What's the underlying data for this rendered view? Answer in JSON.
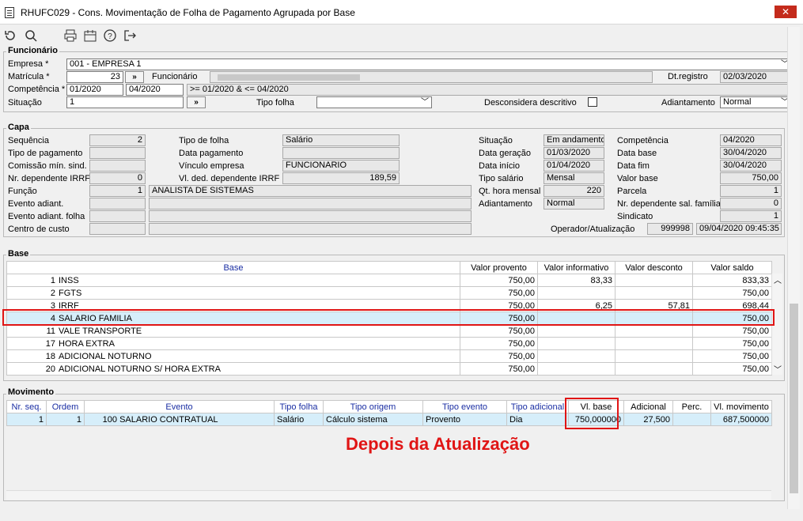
{
  "window": {
    "title": "RHUFC029 - Cons. Movimentação de Folha de Pagamento Agrupada por Base"
  },
  "funcionario": {
    "legend": "Funcionário",
    "empresa_label": "Empresa *",
    "empresa_value": "001 - EMPRESA 1",
    "matricula_label": "Matrícula *",
    "matricula_value": "23",
    "funcionario_label": "Funcionário",
    "dtregistro_label": "Dt.registro",
    "dtregistro_value": "02/03/2020",
    "competencia_label": "Competência *",
    "comp_from": "01/2020",
    "comp_to": "04/2020",
    "comp_range": ">= 01/2020  &  <= 04/2020",
    "situacao_label": "Situação",
    "situacao_value": "1",
    "tipofolha_label": "Tipo folha",
    "desconsidera_label": "Desconsidera descritivo",
    "adiantamento_label": "Adiantamento",
    "adiantamento_value": "Normal",
    "btn_label": "»"
  },
  "capa": {
    "legend": "Capa",
    "sequencia_label": "Sequência",
    "sequencia_value": "2",
    "tipopag_label": "Tipo de pagamento",
    "comissao_label": "Comissão mín. sind.",
    "nrdep_label": "Nr. dependente IRRF",
    "nrdep_value": "0",
    "funcao_label": "Função",
    "funcao_value": "1",
    "funcao_desc": "ANALISTA DE SISTEMAS",
    "evento_adiant_label": "Evento adiant.",
    "evento_adiant_folha_label": "Evento adiant. folha",
    "centro_label": "Centro de custo",
    "tipofolha_label": "Tipo de folha",
    "tipofolha_value": "Salário",
    "datapag_label": "Data pagamento",
    "vinculo_label": "Vínculo empresa",
    "vinculo_value": "FUNCIONARIO",
    "vlded_label": "Vl. ded. dependente IRRF",
    "vlded_value": "189,59",
    "situacao_label": "Situação",
    "situacao_value": "Em andamento",
    "datager_label": "Data geração",
    "datager_value": "01/03/2020",
    "datainicio_label": "Data início",
    "datainicio_value": "01/04/2020",
    "tiposal_label": "Tipo salário",
    "tiposal_value": "Mensal",
    "qthora_label": "Qt. hora mensal",
    "qthora_value": "220",
    "adiant_label": "Adiantamento",
    "adiant_value": "Normal",
    "competencia_label": "Competência",
    "competencia_value": "04/2020",
    "database_label": "Data base",
    "database_value": "30/04/2020",
    "datafim_label": "Data fim",
    "datafim_value": "30/04/2020",
    "valorbase_label": "Valor base",
    "valorbase_value": "750,00",
    "parcela_label": "Parcela",
    "parcela_value": "1",
    "nrdepsal_label": "Nr. dependente sal. família",
    "nrdepsal_value": "0",
    "sindicato_label": "Sindicato",
    "sindicato_value": "1",
    "operador_label": "Operador/Atualização",
    "operador_value": "999998",
    "atualizacao_value": "09/04/2020 09:45:35"
  },
  "base": {
    "legend": "Base",
    "headers": [
      "Base",
      "Valor provento",
      "Valor informativo",
      "Valor desconto",
      "Valor saldo"
    ],
    "rows": [
      {
        "num": "1",
        "name": "INSS",
        "provento": "750,00",
        "informativo": "83,33",
        "desconto": "",
        "saldo": "833,33"
      },
      {
        "num": "2",
        "name": "FGTS",
        "provento": "750,00",
        "informativo": "",
        "desconto": "",
        "saldo": "750,00"
      },
      {
        "num": "3",
        "name": "IRRF",
        "provento": "750,00",
        "informativo": "6,25",
        "desconto": "57,81",
        "saldo": "698,44"
      },
      {
        "num": "4",
        "name": "SALARIO FAMILIA",
        "provento": "750,00",
        "informativo": "",
        "desconto": "",
        "saldo": "750,00"
      },
      {
        "num": "11",
        "name": "VALE TRANSPORTE",
        "provento": "750,00",
        "informativo": "",
        "desconto": "",
        "saldo": "750,00"
      },
      {
        "num": "17",
        "name": "HORA EXTRA",
        "provento": "750,00",
        "informativo": "",
        "desconto": "",
        "saldo": "750,00"
      },
      {
        "num": "18",
        "name": "ADICIONAL NOTURNO",
        "provento": "750,00",
        "informativo": "",
        "desconto": "",
        "saldo": "750,00"
      },
      {
        "num": "20",
        "name": "ADICIONAL NOTURNO S/ HORA EXTRA",
        "provento": "750,00",
        "informativo": "",
        "desconto": "",
        "saldo": "750,00"
      }
    ]
  },
  "movimento": {
    "legend": "Movimento",
    "headers": [
      "Nr. seq.",
      "Ordem",
      "Evento",
      "Tipo folha",
      "Tipo origem",
      "Tipo evento",
      "Tipo adicional",
      "Vl. base",
      "Adicional",
      "Perc.",
      "Vl. movimento"
    ],
    "row": {
      "seq": "1",
      "ordem": "1",
      "evento_cod": "100",
      "evento": "SALARIO CONTRATUAL",
      "tipofolha": "Salário",
      "origem": "Cálculo sistema",
      "tipoevento": "Provento",
      "adicional_tipo": "Dia",
      "vlbase": "750,000000",
      "adicional": "27,500",
      "perc": "",
      "vlmov": "687,500000"
    }
  },
  "annotation": "Depois da Atualização",
  "colors": {
    "highlight": "#e01515",
    "selection": "#d6eefa",
    "header_text": "#1a2ea3"
  }
}
